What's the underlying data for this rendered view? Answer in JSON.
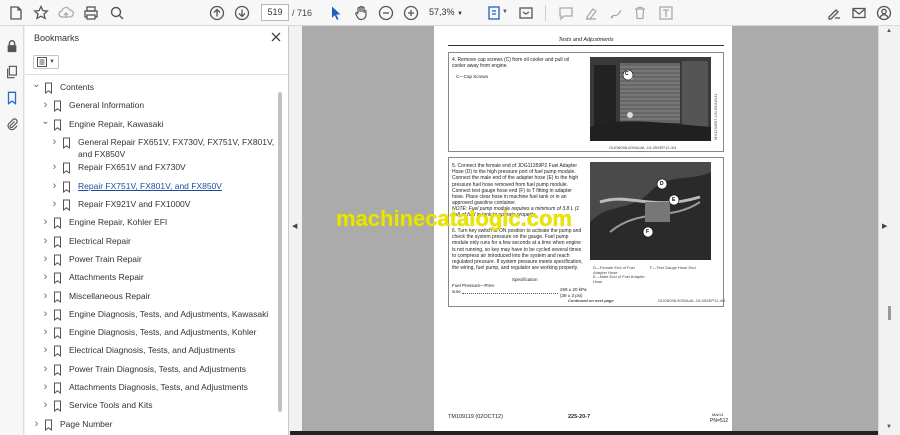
{
  "toolbar": {
    "page_current": "519",
    "page_total": "/ 716",
    "zoom": "57,3%"
  },
  "bookmarks": {
    "title": "Bookmarks",
    "items": [
      {
        "label": "Contents",
        "level": 0,
        "arrow": "down"
      },
      {
        "label": "General Information",
        "level": 1,
        "arrow": "right"
      },
      {
        "label": "Engine Repair, Kawasaki",
        "level": 1,
        "arrow": "down"
      },
      {
        "label": "General Repair FX651V, FX730V, FX751V, FX801V,",
        "label2": "and FX850V",
        "level": 2,
        "arrow": "right"
      },
      {
        "label": "Repair FX651V and FX730V",
        "level": 2,
        "arrow": "right"
      },
      {
        "label": "Repair FX751V, FX801V, and FX850V",
        "level": 2,
        "arrow": "right",
        "highlight": true
      },
      {
        "label": "Repair FX921V and FX1000V",
        "level": 2,
        "arrow": "right"
      },
      {
        "label": "Engine Repair, Kohler EFI",
        "level": 1,
        "arrow": "right"
      },
      {
        "label": "Electrical Repair",
        "level": 1,
        "arrow": "right"
      },
      {
        "label": "Power Train Repair",
        "level": 1,
        "arrow": "right"
      },
      {
        "label": "Attachments Repair",
        "level": 1,
        "arrow": "right"
      },
      {
        "label": "Miscellaneous Repair",
        "level": 1,
        "arrow": "right"
      },
      {
        "label": "Engine Diagnosis, Tests, and Adjustments, Kawasaki",
        "level": 1,
        "arrow": "right"
      },
      {
        "label": "Engine Diagnosis, Tests, and Adjustments, Kohler",
        "level": 1,
        "arrow": "right"
      },
      {
        "label": "Electrical Diagnosis, Tests, and Adjustments",
        "level": 1,
        "arrow": "right"
      },
      {
        "label": "Power Train Diagnosis, Tests, and Adjustments",
        "level": 1,
        "arrow": "right"
      },
      {
        "label": "Attachments Diagnosis, Tests, and Adjustments",
        "level": 1,
        "arrow": "right"
      },
      {
        "label": "Service Tools and Kits",
        "level": 1,
        "arrow": "right"
      },
      {
        "label": "Page Number",
        "level": 0,
        "arrow": "right"
      }
    ]
  },
  "document": {
    "header": "Tests and Adjustments",
    "step4": {
      "text": "4.   Remove cap screws (C) from oil cooler and pull oil cooler away from engine.",
      "legend": "C—Cap Screws",
      "photo_label": "C",
      "ref": "OUO6098,0000A4A -19-05SEP12-3/4",
      "side": "MX1234567-UN-09JUN11"
    },
    "step5": {
      "text": "5.   Connect the female end of JDG11359P2 Fuel Adapter Hose (D) to the high pressure port of fuel pump module. Connect the male end of the adapter hose (E) to the high pressure fuel hose removed from fuel pump module. Connect test gauge hose end (F) to T fitting in adapter hose. Place clear hose in machine fuel tank or in an approved gasoline container.",
      "note": "NOTE: Fuel pump module requires a minimum of 3.8 L (1 gal) of fuel in tank to operate properly.",
      "step6": "6.   Turn key switch to ON position to activate the pump and check the system pressure on the gauge. Fuel pump module only runs for a few seconds at a time when engine is not running, so key may have to be cycled several times to compress air introduced into the system and reach regulated pressure. If system pressure meets specification, the wiring, fuel pump, and regulator are working properly.",
      "spec_title": "Specification",
      "spec_label": "Fuel Pressure—Pres-",
      "spec_label2": "sure",
      "spec_value": "269 ± 20 kPa",
      "spec_value2": "(39 ± 3 psi)",
      "legend_d": "D—Female End of Fuel Adapter Hose",
      "legend_e": "E—Male End of Fuel Adapter Hose",
      "legend_f": "F—Test Gauge Hose End",
      "photo_labels": [
        "D",
        "E",
        "F"
      ],
      "continued": "Continued on next page",
      "ref": "OUO6098,0000A4A -19-05SEP12-4/4"
    },
    "footer_left": "TM109119 (02OCT12)",
    "footer_center": "225-20-7",
    "footer_right": "PN=512",
    "footer_right_small": "Mar14"
  },
  "watermark": "machinecatalogic.com"
}
